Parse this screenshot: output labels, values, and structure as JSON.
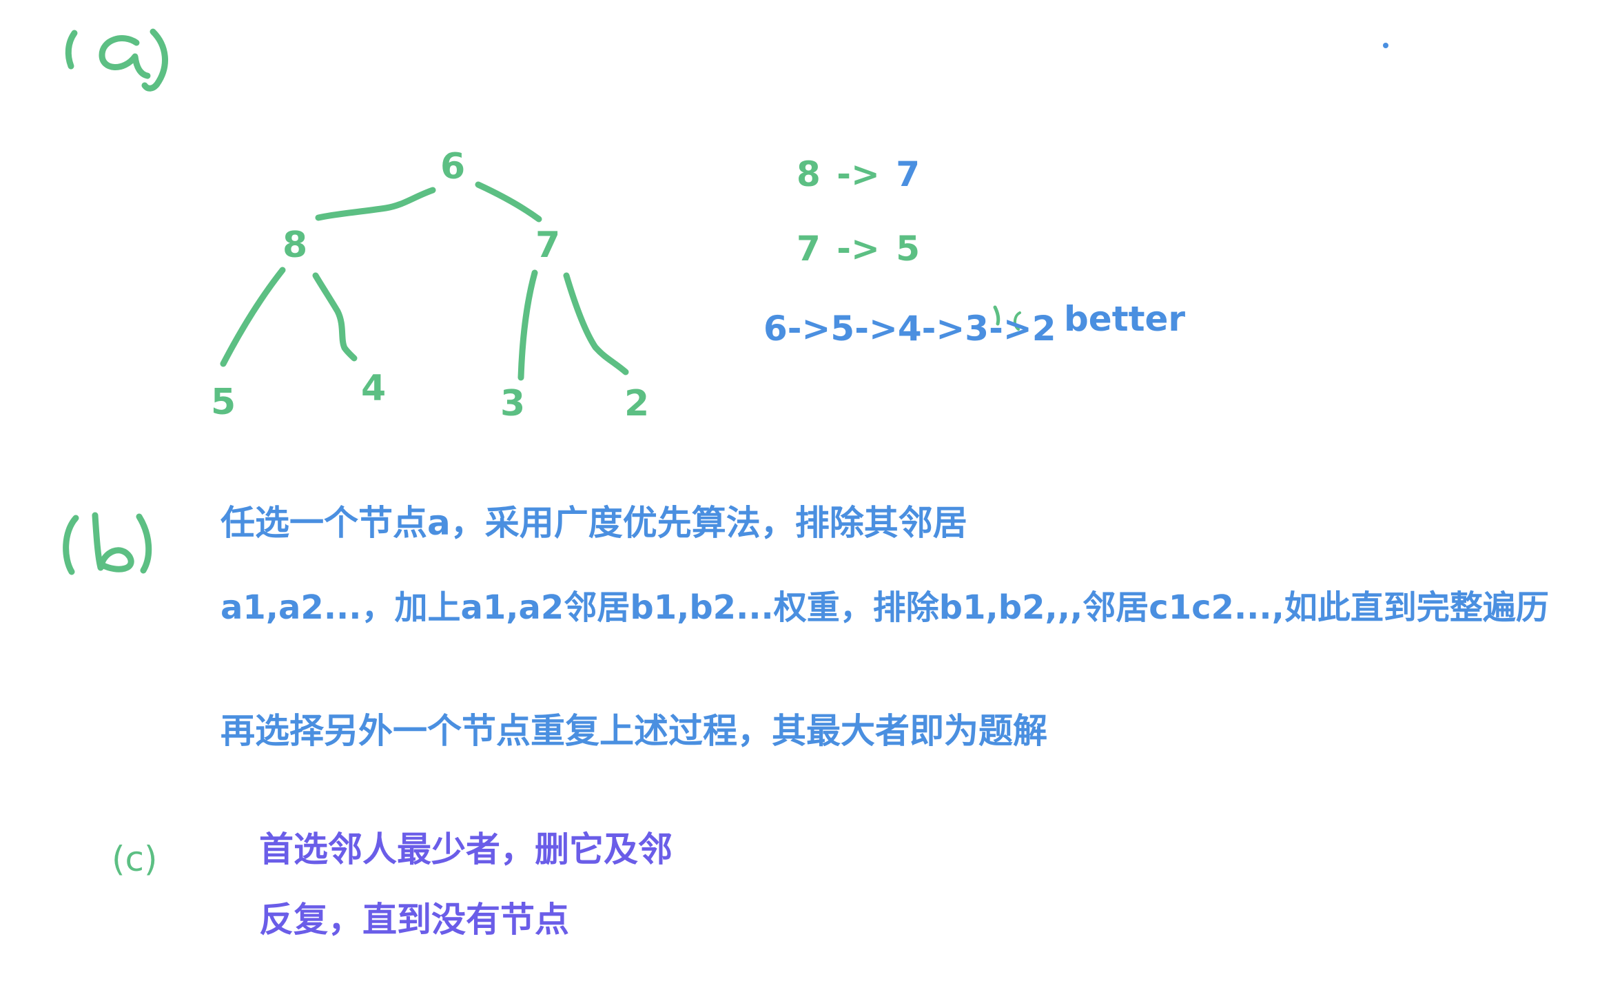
{
  "section_a": {
    "label": "(a)",
    "tree": {
      "nodes": [
        "6",
        "8",
        "7",
        "5",
        "4",
        "3",
        "2"
      ]
    },
    "steps": [
      {
        "from": "8",
        "arrow": "->",
        "to": "7"
      },
      {
        "from": "7",
        "arrow": "->",
        "to": "5"
      }
    ],
    "chain": "6->5->4->3->2",
    "better": "better"
  },
  "section_b": {
    "label": "(b)",
    "lines": [
      "任选一个节点a，采用广度优先算法，排除其邻居",
      "a1,a2...，加上a1,a2邻居b1,b2...权重，排除b1,b2,,,邻居c1c2...,如此直到完整遍历",
      "再选择另外一个节点重复上述过程，其最大者即为题解"
    ]
  },
  "section_c": {
    "label": "(c)",
    "lines": [
      "首选邻人最少者，删它及邻",
      "反复，直到没有节点"
    ]
  },
  "colors": {
    "green": "#5cbf83",
    "blue": "#4a8fe0",
    "purple": "#6a5de8"
  }
}
